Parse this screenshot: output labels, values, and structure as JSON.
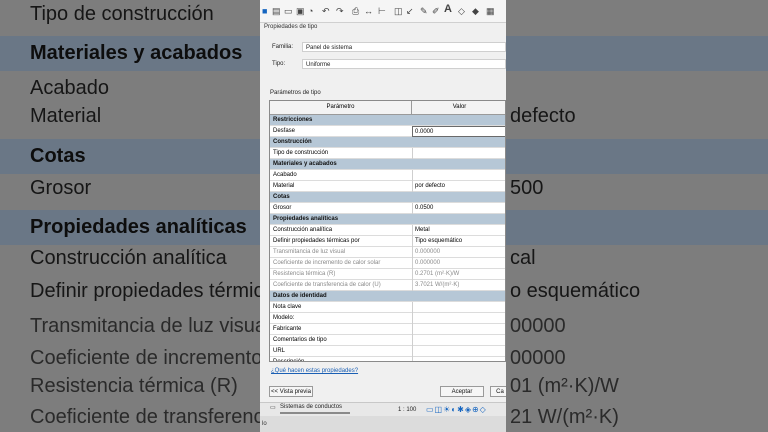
{
  "background": {
    "rows": [
      {
        "label": "Tipo de construcción",
        "value": "",
        "kind": "normal"
      },
      {
        "label": "Materiales y acabados",
        "value": "",
        "kind": "header"
      },
      {
        "label": "Acabado",
        "value": "",
        "kind": "normal"
      },
      {
        "label": "Material",
        "value": "defecto",
        "kind": "normal"
      },
      {
        "label": "Cotas",
        "value": "",
        "kind": "header"
      },
      {
        "label": "Grosor",
        "value": "500",
        "kind": "normal"
      },
      {
        "label": "Propiedades analíticas",
        "value": "",
        "kind": "header"
      },
      {
        "label": "Construcción analítica",
        "value": "cal",
        "kind": "normal"
      },
      {
        "label": "Definir propiedades térmic",
        "value": "o esquemático",
        "kind": "normal"
      },
      {
        "label": "Transmitancia de luz visual",
        "value": "00000",
        "kind": "gray"
      },
      {
        "label": "Coeficiente de incremento",
        "value": "00000",
        "kind": "gray"
      },
      {
        "label": "Resistencia térmica (R)",
        "value": "01 (m²·K)/W",
        "kind": "gray"
      },
      {
        "label": "Coeficiente de transferenc",
        "value": "21 W/(m²·K)",
        "kind": "gray"
      }
    ]
  },
  "dialog": {
    "title": "Propiedades de tipo",
    "family_label": "Familia:",
    "family_value": "Panel de sistema",
    "type_label": "Tipo:",
    "type_value": "Uniforme",
    "params_label": "Parámetros de tipo",
    "col_param": "Parámetro",
    "col_value": "Valor",
    "rows": [
      {
        "label": "Restricciones",
        "value": "",
        "kind": "group"
      },
      {
        "label": "Desfase",
        "value": "0.0000",
        "kind": "selected"
      },
      {
        "label": "Construcción",
        "value": "",
        "kind": "group"
      },
      {
        "label": "Tipo de construcción",
        "value": "",
        "kind": "normal"
      },
      {
        "label": "Materiales y acabados",
        "value": "",
        "kind": "group"
      },
      {
        "label": "Acabado",
        "value": "",
        "kind": "normal"
      },
      {
        "label": "Material",
        "value": "por defecto",
        "kind": "normal"
      },
      {
        "label": "Cotas",
        "value": "",
        "kind": "group"
      },
      {
        "label": "Grosor",
        "value": "0.0500",
        "kind": "normal"
      },
      {
        "label": "Propiedades analíticas",
        "value": "",
        "kind": "group"
      },
      {
        "label": "Construcción analítica",
        "value": "Metal",
        "kind": "normal"
      },
      {
        "label": "Definir propiedades térmicas por",
        "value": "Tipo esquemático",
        "kind": "normal"
      },
      {
        "label": "Transmitancia de luz visual",
        "value": "0.000000",
        "kind": "gray"
      },
      {
        "label": "Coeficiente de incremento de calor solar",
        "value": "0.000000",
        "kind": "gray"
      },
      {
        "label": "Resistencia térmica (R)",
        "value": "0.2701 (m²·K)/W",
        "kind": "gray"
      },
      {
        "label": "Coeficiente de transferencia de calor (U)",
        "value": "3.7021 W/(m²·K)",
        "kind": "gray"
      },
      {
        "label": "Datos de identidad",
        "value": "",
        "kind": "group"
      },
      {
        "label": "Nota clave",
        "value": "",
        "kind": "normal"
      },
      {
        "label": "Modelo:",
        "value": "",
        "kind": "normal"
      },
      {
        "label": "Fabricante",
        "value": "",
        "kind": "normal"
      },
      {
        "label": "Comentarios de tipo",
        "value": "",
        "kind": "normal"
      },
      {
        "label": "URL",
        "value": "",
        "kind": "normal"
      },
      {
        "label": "Descripción",
        "value": "",
        "kind": "normal"
      }
    ],
    "help_link": "¿Qué hacen estas propiedades?",
    "preview_button": "<< Vista previa",
    "accept_button": "Aceptar",
    "cancel_button": "Ca"
  },
  "statusbar": {
    "tree_item": "Sistemas de conductos",
    "scale": "1 : 100"
  },
  "bottombar": {
    "text": "lo"
  }
}
